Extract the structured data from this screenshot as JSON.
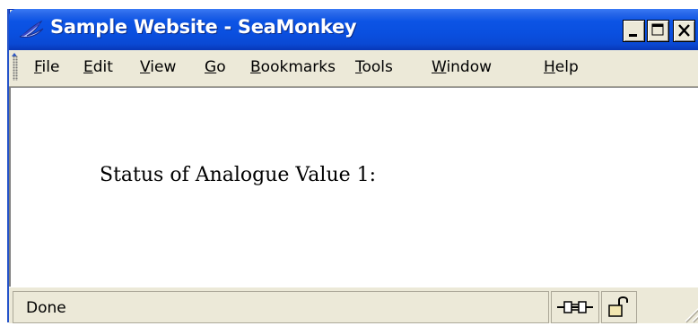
{
  "window": {
    "title": "Sample Website - SeaMonkey",
    "buttons": {
      "minimize": "minimize-icon",
      "maximize": "maximize-icon",
      "close": "close-icon"
    },
    "colors": {
      "titlebar": "#0a4fdf",
      "chrome": "#ece9d8"
    }
  },
  "menubar": {
    "items": [
      {
        "label": "File",
        "mnemonic": "F",
        "rest": "ile"
      },
      {
        "label": "Edit",
        "mnemonic": "E",
        "rest": "dit"
      },
      {
        "label": "View",
        "mnemonic": "V",
        "rest": "iew"
      },
      {
        "label": "Go",
        "mnemonic": "G",
        "rest": "o"
      },
      {
        "label": "Bookmarks",
        "mnemonic": "B",
        "rest": "ookmarks"
      },
      {
        "label": "Tools",
        "mnemonic": "T",
        "rest": "ools"
      },
      {
        "label": "Window",
        "mnemonic": "W",
        "rest": "indow"
      },
      {
        "label": "Help",
        "mnemonic": "H",
        "rest": "elp"
      }
    ]
  },
  "page": {
    "status_label": "Status of Analogue Value 1:"
  },
  "statusbar": {
    "text": "Done",
    "icons": [
      "online-connection-icon",
      "security-lock-icon"
    ]
  }
}
